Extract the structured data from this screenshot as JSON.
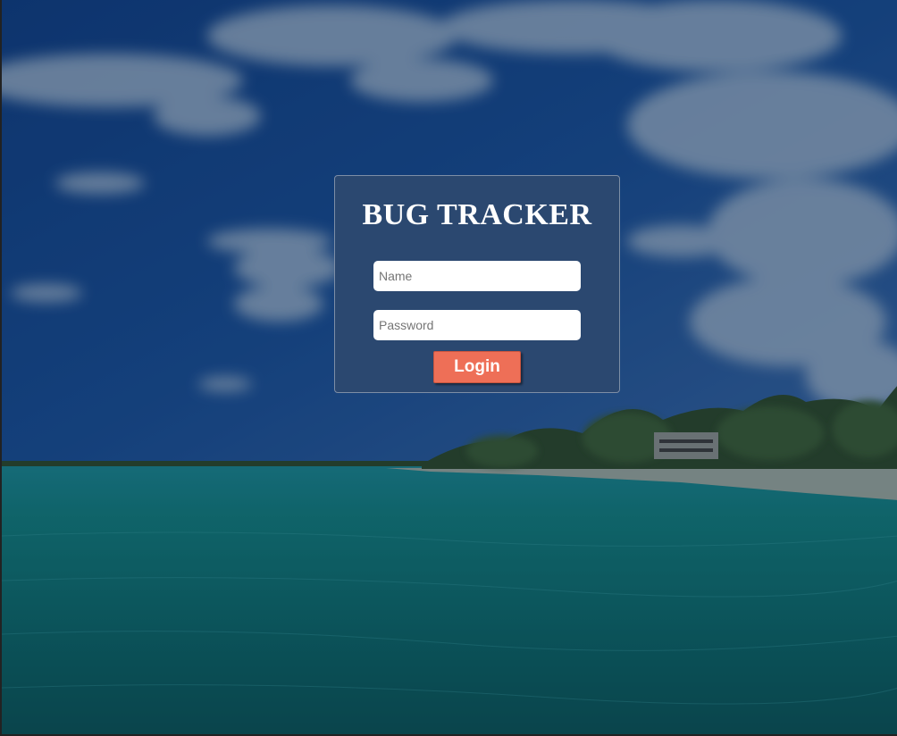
{
  "login": {
    "title": "BUG TRACKER",
    "name_placeholder": "Name",
    "password_placeholder": "Password",
    "submit_label": "Login"
  },
  "theme": {
    "card_color": "#2b4870",
    "button_color": "#ee6f57",
    "text_color": "#ffffff"
  }
}
